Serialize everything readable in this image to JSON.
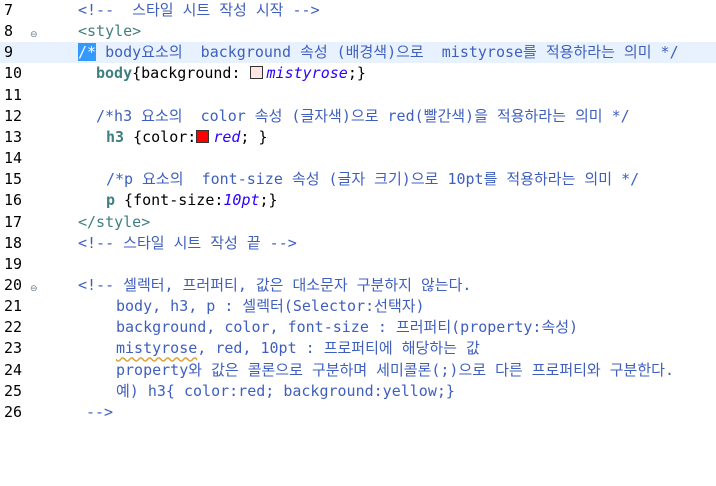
{
  "colors": {
    "mistyrose": "#ffe4e1",
    "red": "#ff0000",
    "active_line": "#e8f2fe",
    "selection": "#3399ff"
  },
  "lines": [
    {
      "num": "7",
      "text": "<!--  스타일 시트 작성 시작 -->"
    },
    {
      "num": "8",
      "text": "<style>"
    },
    {
      "num": "9",
      "hl": "/*",
      "text": " body요소의  background 속성 (배경색)으로  mistyrose를 적용하라는 의미 */"
    },
    {
      "num": "10",
      "sel": "body",
      "pre": "{background: ",
      "val": "mistyrose",
      "post": ";}"
    },
    {
      "num": "11",
      "text": ""
    },
    {
      "num": "12",
      "text": "/*h3 요소의  color 속성 (글자색)으로 red(빨간색)을 적용하라는 의미 */"
    },
    {
      "num": "13",
      "sel": "h3",
      "pre": " {color:",
      "val": "red",
      "post": "; }"
    },
    {
      "num": "14",
      "text": ""
    },
    {
      "num": "15",
      "text": "/*p 요소의  font-size 속성 (글자 크기)으로 10pt를 적용하라는 의미 */"
    },
    {
      "num": "16",
      "sel": "p",
      "pre": " {font-size:",
      "val": "10pt",
      "post": ";}"
    },
    {
      "num": "17",
      "text": "</style>"
    },
    {
      "num": "18",
      "text": "<!-- 스타일 시트 작성 끝 -->"
    },
    {
      "num": "19",
      "text": ""
    },
    {
      "num": "20",
      "text": "<!-- 셀렉터, 프러퍼티, 값은 대소문자 구분하지 않는다."
    },
    {
      "num": "21",
      "text": "body, h3, p : 셀렉터(Selector:선택자)"
    },
    {
      "num": "22",
      "text": "background, color, font-size : 프러퍼티(property:속성)"
    },
    {
      "num": "23",
      "sq": "mistyrose",
      "text": ", red, 10pt : 프로퍼티에 해당하는 값"
    },
    {
      "num": "24",
      "text": "property와 값은 콜론으로 구분하며 세미콜론(;)으로 다른 프로퍼티와 구분한다."
    },
    {
      "num": "25",
      "text": "예) h3{ color:red; background:yellow;}"
    },
    {
      "num": "26",
      "text": "-->"
    }
  ]
}
